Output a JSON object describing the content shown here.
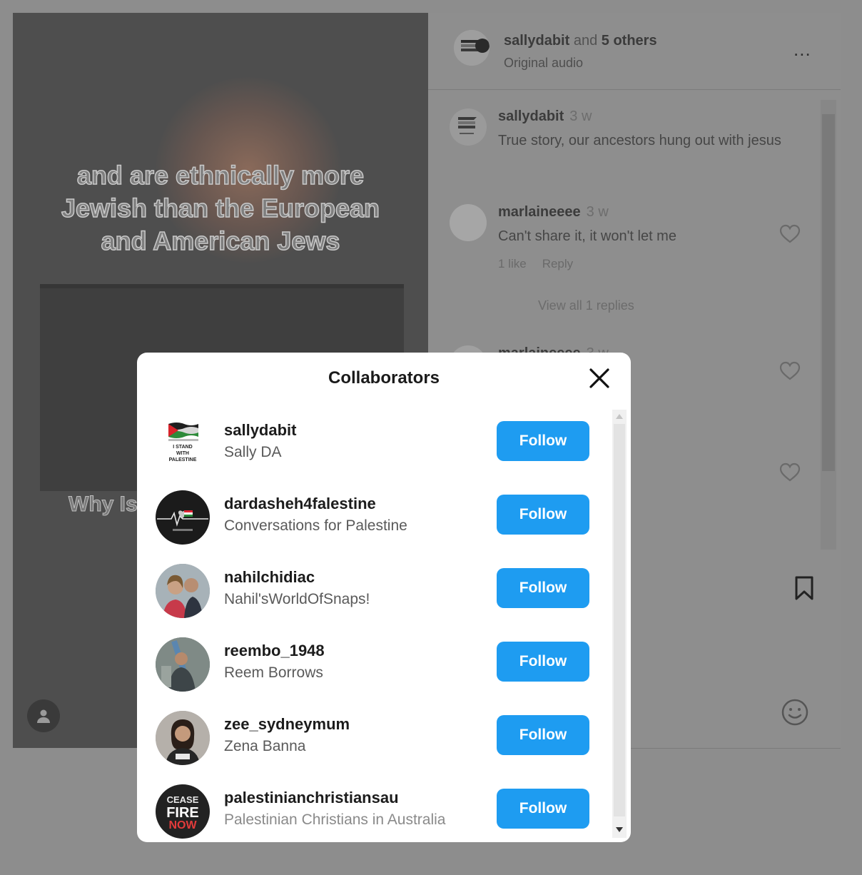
{
  "background": {
    "video_caption_lines": [
      "and are ethnically more",
      "Jewish than the European",
      "and American Jews"
    ],
    "video_subcaption": "Why Is",
    "post_header": {
      "author": "sallydabit",
      "and_text": "and",
      "others": "5 others",
      "audio": "Original audio",
      "more": "..."
    },
    "comments": [
      {
        "name": "sallydabit",
        "time": "3 w",
        "text": "True story, our ancestors hung out with jesus",
        "likes": "",
        "reply": ""
      },
      {
        "name": "marlaineeee",
        "time": "3 w",
        "text": "Can't share it, it won't let me",
        "likes": "1 like",
        "reply": "Reply"
      },
      {
        "name": "marlaineeee",
        "time": "3 w",
        "text": "",
        "likes": "",
        "reply": ""
      }
    ],
    "view_replies": "View all 1 replies"
  },
  "modal": {
    "title": "Collaborators",
    "follow_label": "Follow",
    "collaborators": [
      {
        "username": "sallydabit",
        "fullname": "Sally DA"
      },
      {
        "username": "dardasheh4falestine",
        "fullname": "Conversations for Palestine"
      },
      {
        "username": "nahilchidiac",
        "fullname": "Nahil'sWorldOfSnaps!"
      },
      {
        "username": "reembo_1948",
        "fullname": "Reem Borrows"
      },
      {
        "username": "zee_sydneymum",
        "fullname": "Zena Banna"
      },
      {
        "username": "palestinianchristiansau",
        "fullname": "Palestinian Christians in Australia"
      }
    ],
    "avatar_text": {
      "sally_badge": [
        "I STAND",
        "WITH",
        "PALESTINE"
      ],
      "cease": [
        "CEASE",
        "FIRE",
        "NOW"
      ]
    }
  },
  "colors": {
    "follow_button": "#1e9cf1",
    "overlay": "#8d8d8d",
    "modal_bg": "#ffffff"
  }
}
